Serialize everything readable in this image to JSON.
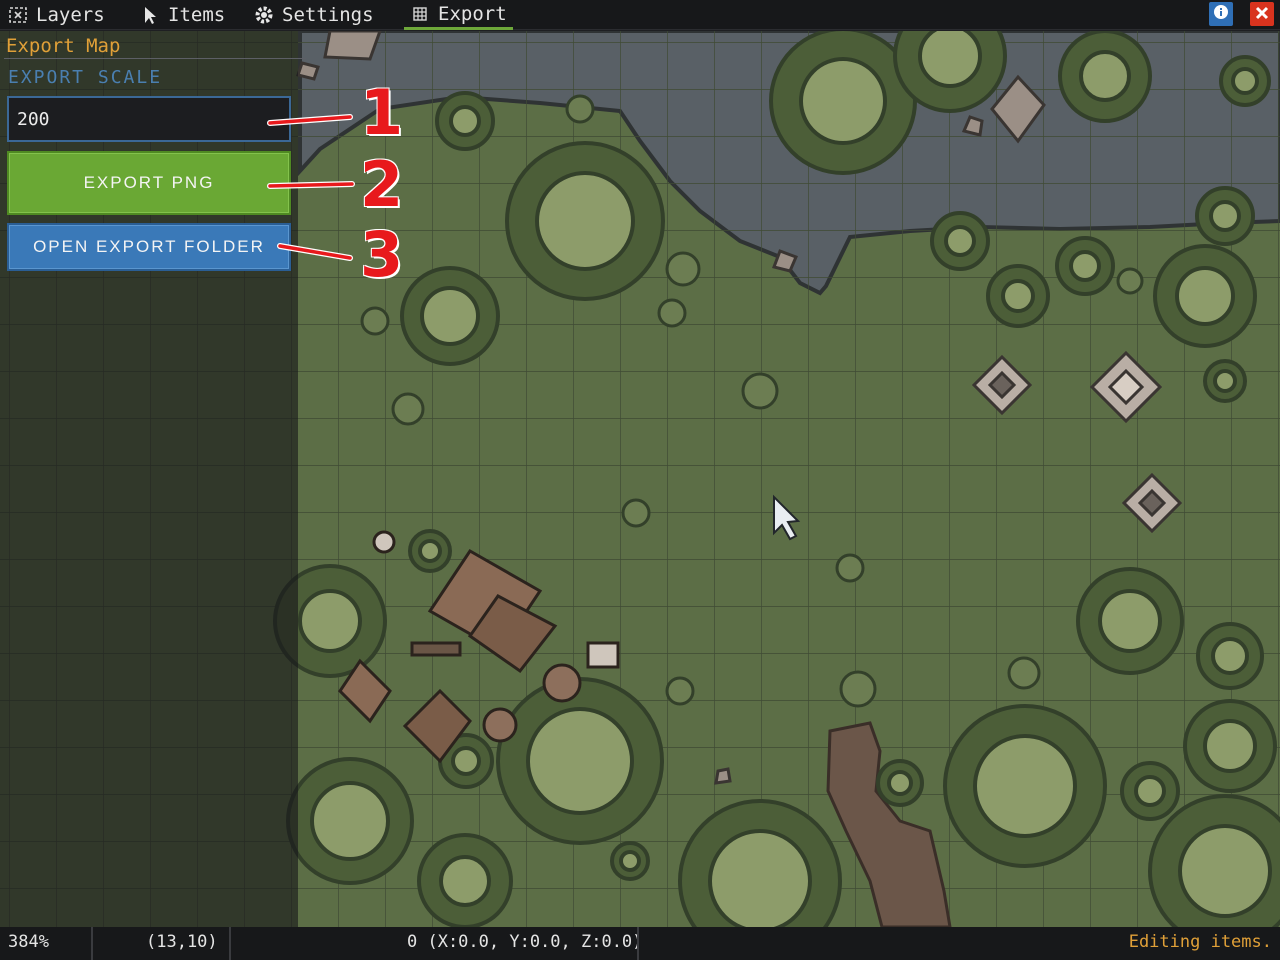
{
  "menu": {
    "tabs": [
      {
        "label": "Layers",
        "icon": "layers-icon"
      },
      {
        "label": "Items",
        "icon": "pointer-icon"
      },
      {
        "label": "Settings",
        "icon": "gear-icon"
      },
      {
        "label": "Export",
        "icon": "export-grid-icon"
      }
    ],
    "active_tab": "Export",
    "info_icon": "info-icon",
    "close_icon": "close-icon",
    "accent_color": "#6ea83a"
  },
  "export_panel": {
    "heading": "Export Map",
    "scale_label": "EXPORT SCALE",
    "scale_value": "200",
    "export_png_label": "EXPORT PNG",
    "open_folder_label": "OPEN EXPORT FOLDER",
    "export_button_color": "#6aa834",
    "folder_button_color": "#3a79b8",
    "heading_color": "#e0a038",
    "label_color": "#4a7fb0"
  },
  "annotations": {
    "callouts": [
      "1",
      "2",
      "3"
    ],
    "color": "#e8191c"
  },
  "status_bar": {
    "zoom": "384%",
    "tile": "(13,10)",
    "selection": "0 (X:0.0, Y:0.0, Z:0.0)",
    "status": "Editing items."
  },
  "map": {
    "water_color": "#596066",
    "grass_color": "#5c6e46",
    "tree_light": "#8d9c6a",
    "tree_dark": "#4c5e38"
  }
}
